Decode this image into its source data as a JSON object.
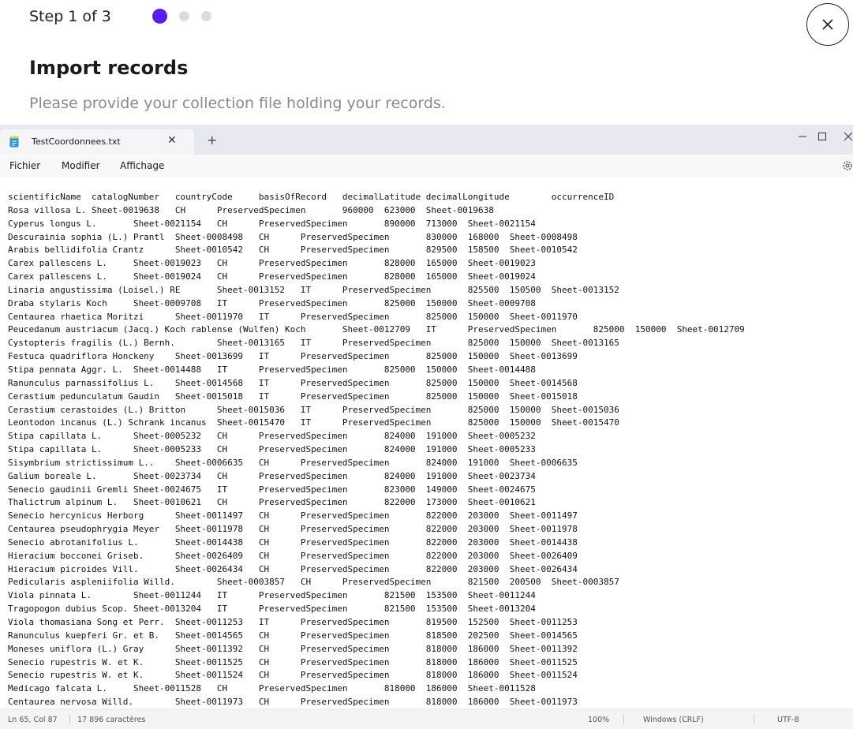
{
  "wizard": {
    "step_label": "Step 1 of 3",
    "steps": [
      {
        "active": true
      },
      {
        "active": false
      },
      {
        "active": false
      }
    ],
    "title": "Import records",
    "subtitle": "Please provide your collection file holding your records.",
    "accent_color": "#5a1cf0"
  },
  "notepad": {
    "tab_title": "TestCoordonnees.txt",
    "menu": [
      "Fichier",
      "Modifier",
      "Affichage"
    ],
    "lines": [
      "scientificName  catalogNumber   countryCode     basisOfRecord   decimalLatitude decimalLongitude        occurrenceID",
      "Rosa villosa L. Sheet-0019638   CH      PreservedSpecimen       960000  623000  Sheet-0019638",
      "Cyperus longus L.       Sheet-0021154   CH      PreservedSpecimen       890000  713000  Sheet-0021154",
      "Descurainia sophia (L.) Prantl  Sheet-0008498   CH      PreservedSpecimen       830000  168000  Sheet-0008498",
      "Arabis bellidifolia Crantz      Sheet-0010542   CH      PreservedSpecimen       829500  158500  Sheet-0010542",
      "Carex pallescens L.     Sheet-0019023   CH      PreservedSpecimen       828000  165000  Sheet-0019023",
      "Carex pallescens L.     Sheet-0019024   CH      PreservedSpecimen       828000  165000  Sheet-0019024",
      "Linaria angustissima (Loisel.) RE       Sheet-0013152   IT      PreservedSpecimen       825500  150500  Sheet-0013152",
      "Draba stylaris Koch     Sheet-0009708   IT      PreservedSpecimen       825000  150000  Sheet-0009708",
      "Centaurea rhaetica Moritzi      Sheet-0011970   IT      PreservedSpecimen       825000  150000  Sheet-0011970",
      "Peucedanum austriacum (Jacq.) Koch rablense (Wulfen) Koch       Sheet-0012709   IT      PreservedSpecimen       825000  150000  Sheet-0012709",
      "Cystopteris fragilis (L.) Bernh.        Sheet-0013165   IT      PreservedSpecimen       825000  150000  Sheet-0013165",
      "Festuca quadriflora Honckeny    Sheet-0013699   IT      PreservedSpecimen       825000  150000  Sheet-0013699",
      "Stipa pennata Aggr. L.  Sheet-0014488   IT      PreservedSpecimen       825000  150000  Sheet-0014488",
      "Ranunculus parnassifolius L.    Sheet-0014568   IT      PreservedSpecimen       825000  150000  Sheet-0014568",
      "Cerastium pedunculatum Gaudin   Sheet-0015018   IT      PreservedSpecimen       825000  150000  Sheet-0015018",
      "Cerastium cerastoides (L.) Britton      Sheet-0015036   IT      PreservedSpecimen       825000  150000  Sheet-0015036",
      "Leontodon incanus (L.) Schrank incanus  Sheet-0015470   IT      PreservedSpecimen       825000  150000  Sheet-0015470",
      "Stipa capillata L.      Sheet-0005232   CH      PreservedSpecimen       824000  191000  Sheet-0005232",
      "Stipa capillata L.      Sheet-0005233   CH      PreservedSpecimen       824000  191000  Sheet-0005233",
      "Sisymbrium strictissimum L..    Sheet-0006635   CH      PreservedSpecimen       824000  191000  Sheet-0006635",
      "Galium boreale L.       Sheet-0023734   CH      PreservedSpecimen       824000  191000  Sheet-0023734",
      "Senecio gaudinii Gremli Sheet-0024675   IT      PreservedSpecimen       823000  149000  Sheet-0024675",
      "Thalictrum alpinum L.   Sheet-0010621   CH      PreservedSpecimen       822000  173000  Sheet-0010621",
      "Senecio hercynicus Herborg      Sheet-0011497   CH      PreservedSpecimen       822000  203000  Sheet-0011497",
      "Centaurea pseudophrygia Meyer   Sheet-0011978   CH      PreservedSpecimen       822000  203000  Sheet-0011978",
      "Senecio abrotanifolius L.       Sheet-0014438   CH      PreservedSpecimen       822000  203000  Sheet-0014438",
      "Hieracium bocconei Griseb.      Sheet-0026409   CH      PreservedSpecimen       822000  203000  Sheet-0026409",
      "Hieracium picroides Vill.       Sheet-0026434   CH      PreservedSpecimen       822000  203000  Sheet-0026434",
      "Pedicularis aspleniifolia Willd.        Sheet-0003857   CH      PreservedSpecimen       821500  200500  Sheet-0003857",
      "Viola pinnata L.        Sheet-0011244   IT      PreservedSpecimen       821500  153500  Sheet-0011244",
      "Tragopogon dubius Scop. Sheet-0013204   IT      PreservedSpecimen       821500  153500  Sheet-0013204",
      "Viola thomasiana Song et Perr.  Sheet-0011253   IT      PreservedSpecimen       819500  152500  Sheet-0011253",
      "Ranunculus kuepferi Gr. et B.   Sheet-0014565   CH      PreservedSpecimen       818500  202500  Sheet-0014565",
      "Moneses uniflora (L.) Gray      Sheet-0011392   CH      PreservedSpecimen       818000  186000  Sheet-0011392",
      "Senecio rupestris W. et K.      Sheet-0011525   CH      PreservedSpecimen       818000  186000  Sheet-0011525",
      "Senecio rupestris W. et K.      Sheet-0011524   CH      PreservedSpecimen       818000  186000  Sheet-0011524",
      "Medicago falcata L.     Sheet-0011528   CH      PreservedSpecimen       818000  186000  Sheet-0011528",
      "Centaurea nervosa Willd.        Sheet-0011973   CH      PreservedSpecimen       818000  186000  Sheet-0011973"
    ],
    "status": {
      "position": "Ln 65, Col 87",
      "chars": "17 896 caractères",
      "zoom": "100%",
      "line_ending": "Windows (CRLF)",
      "encoding": "UTF-8"
    }
  }
}
